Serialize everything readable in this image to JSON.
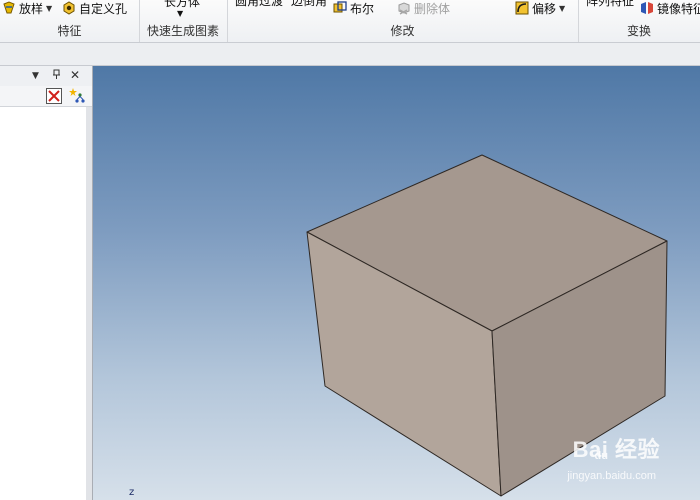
{
  "ribbon": {
    "groups": [
      {
        "label": "特征",
        "buttons": [
          {
            "label": "放样"
          },
          {
            "label": "自定义孔"
          }
        ]
      },
      {
        "label": "快速生成图素",
        "buttons": [
          {
            "label": "长方体"
          }
        ]
      },
      {
        "label": "修改",
        "buttons": [
          {
            "label": "圆角过渡"
          },
          {
            "label": "边倒角"
          },
          {
            "label": "布尔"
          },
          {
            "label": "删除体"
          },
          {
            "label": "偏移"
          }
        ]
      },
      {
        "label": "变换",
        "buttons": [
          {
            "label": "阵列特征"
          },
          {
            "label": "镜像特征"
          }
        ]
      }
    ]
  },
  "panel": {
    "header_icons": [
      "dropdown-icon",
      "pin-icon",
      "close-icon"
    ],
    "toolbar_icons": [
      "delete-icon",
      "new-star-icon"
    ]
  },
  "viewport": {
    "axis_label": "z",
    "watermark": "Bai 经验",
    "watermark_paw": "du",
    "watermark_url": "jingyan.baidu.com",
    "box_colors": {
      "top": "#a5988f",
      "front": "#b2a59b",
      "right": "#9e928a",
      "edge": "#2e2824"
    }
  }
}
